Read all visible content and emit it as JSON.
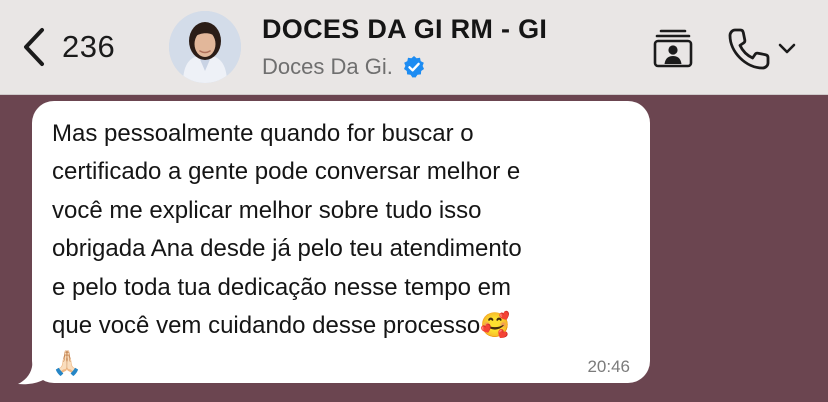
{
  "header": {
    "back_count": "236",
    "contact_name": "DOCES DA GI RM - GI",
    "business_name": "Doces Da Gi.",
    "verified": true
  },
  "message": {
    "text": "Mas pessoalmente quando for buscar o\ncertificado a gente pode conversar melhor e\nvocê me explicar melhor sobre tudo isso\nobrigada Ana desde já pelo teu atendimento\ne pelo toda tua dedicação nesse tempo em\nque você vem cuidando desse processo🥰\n🙏🏻",
    "time": "20:46"
  },
  "colors": {
    "header_bg": "#e9e6e5",
    "chat_bg": "#6b4550",
    "bubble_bg": "#ffffff",
    "verified_badge": "#1d8cf2"
  },
  "icons": {
    "back": "chevron-left-icon",
    "verified": "verified-badge-icon",
    "contact_card": "contact-card-icon",
    "call": "phone-icon",
    "call_menu": "chevron-down-icon"
  }
}
